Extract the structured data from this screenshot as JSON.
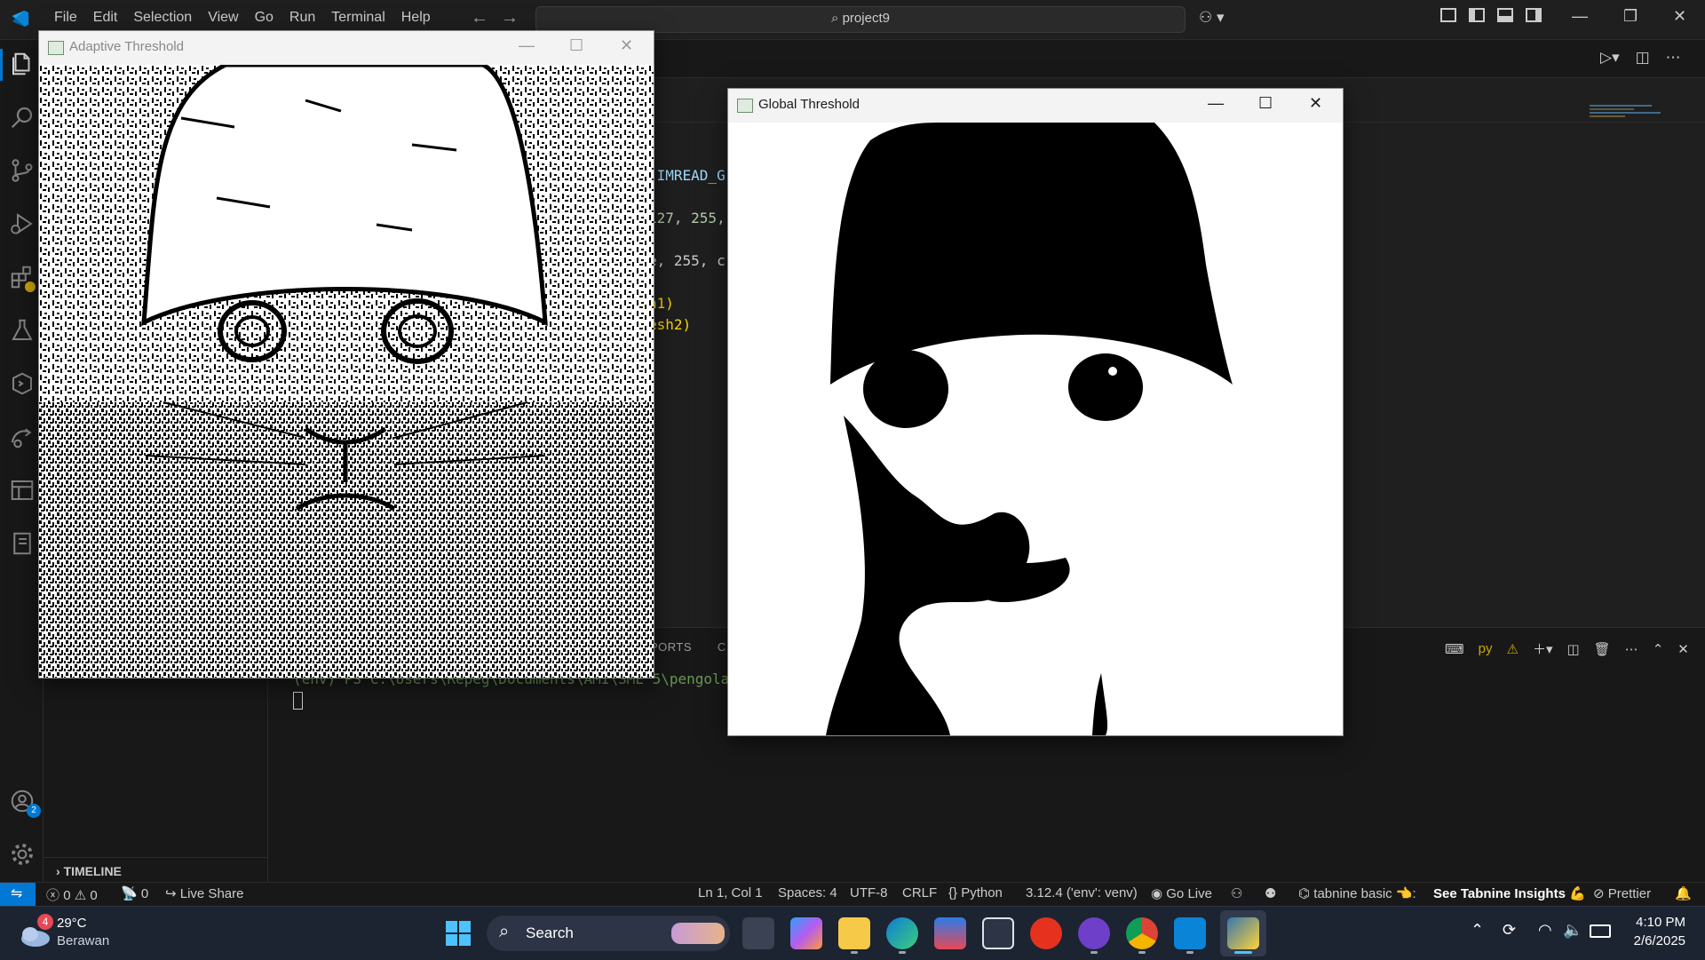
{
  "vscode": {
    "menu": [
      "File",
      "Edit",
      "Selection",
      "View",
      "Go",
      "Run",
      "Terminal",
      "Help"
    ],
    "command_center": "project9",
    "code_fragments": [
      ".IMREAD_G",
      "127, 255,",
      "e, 255, c",
      "h1)",
      "esh2)"
    ],
    "panel_tabs_partial": [
      "PORTS",
      "C"
    ],
    "panel_actions": {
      "terminal_label": "py"
    },
    "terminal_prompt": "(env) PS C:\\Users\\Repeg\\Documents\\AMI\\SME 5\\pengolahan",
    "timeline_label": "TIMELINE",
    "accounts_badge": "2"
  },
  "statusbar": {
    "errors": "0",
    "warnings": "0",
    "ports": "0",
    "live_share": "Live Share",
    "position": "Ln 1, Col 1",
    "spaces": "Spaces: 4",
    "encoding": "UTF-8",
    "eol": "CRLF",
    "language": "Python",
    "interpreter": "3.12.4 ('env': venv)",
    "go_live": "Go Live",
    "tabnine": "tabnine basic 👈:",
    "tabnine_insights": "See Tabnine Insights 💪",
    "prettier": "Prettier"
  },
  "windows": {
    "adaptive": {
      "title": "Adaptive Threshold"
    },
    "global": {
      "title": "Global Threshold"
    }
  },
  "taskbar": {
    "weather_temp": "29°C",
    "weather_desc": "Berawan",
    "weather_badge": "4",
    "search_placeholder": "Search",
    "time": "4:10 PM",
    "date": "2/6/2025"
  },
  "colors": {
    "accent": "#0078d4",
    "editor_bg": "#1f1f1f",
    "taskbar_bg": "#1c2331"
  }
}
